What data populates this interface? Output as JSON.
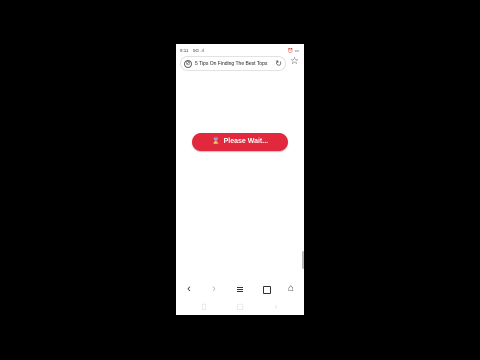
{
  "status_bar": {
    "time": "9:11",
    "signal": "5G .ıl",
    "right_icons": "⏰ ▭"
  },
  "browser": {
    "url_title": "5 Tips On Finding The Best Tops",
    "site_icon": "compass-icon",
    "reload_icon": "reload-icon",
    "bookmark_icon": "star-icon"
  },
  "content": {
    "loading_button_label": "Please Wait...",
    "loading_icon": "hourglass-icon",
    "accent_color": "#e2283c"
  },
  "bottom_nav": {
    "back": "‹",
    "forward": "›"
  }
}
